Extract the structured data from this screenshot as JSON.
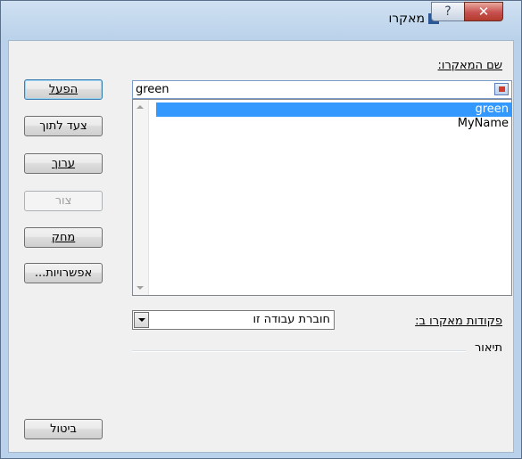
{
  "window": {
    "title": "מאקרו",
    "help_glyph": "?",
    "close_glyph": "✕"
  },
  "macro_name": {
    "label": "שם המאקרו:",
    "value": "green"
  },
  "macros": [
    {
      "name": "green",
      "selected": true
    },
    {
      "name": "MyName",
      "selected": false
    }
  ],
  "buttons": {
    "run": "הפעל",
    "step_into": "צעד לתוך",
    "edit": "ערוך",
    "create": "צור",
    "delete": "מחק",
    "options": "אפשרויות...",
    "cancel": "ביטול"
  },
  "macros_in": {
    "label": "פקודות מאקרו ב:",
    "value": "חוברת עבודה זו"
  },
  "description": {
    "label": "תיאור"
  }
}
